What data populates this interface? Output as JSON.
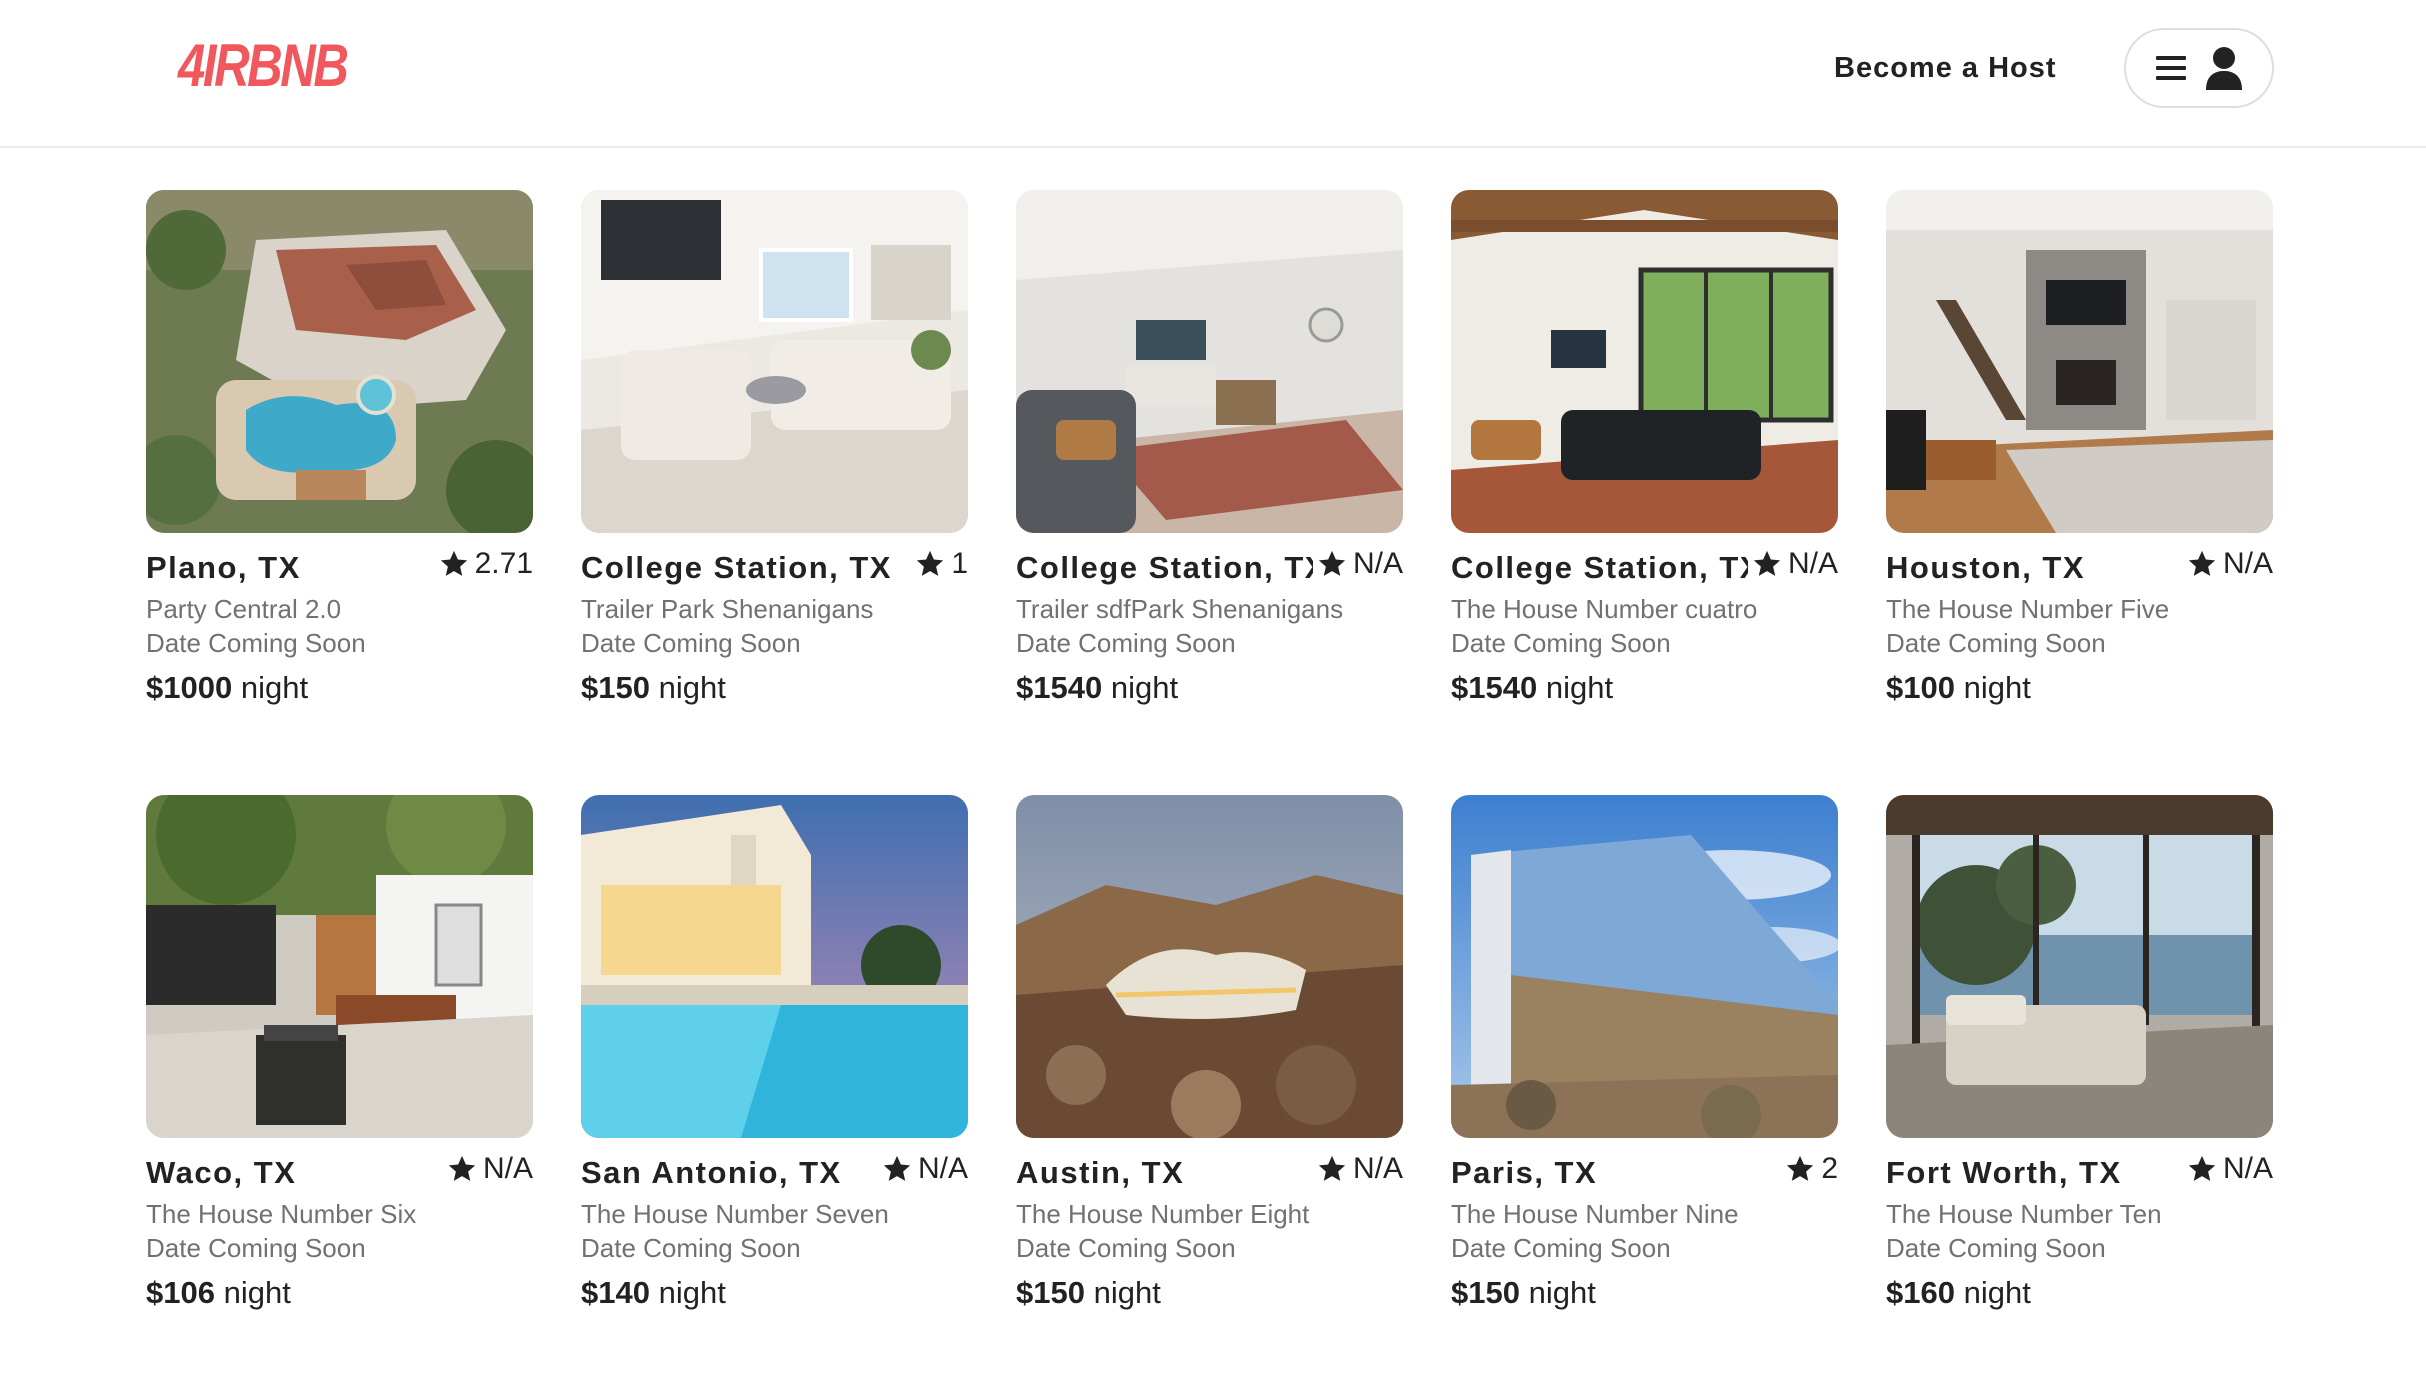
{
  "header": {
    "logo_text": "4IRBNB",
    "become_host_label": "Become a Host",
    "menu_icon": "hamburger-menu-icon",
    "user_icon": "user-avatar-icon",
    "brand_color": "#f0585e"
  },
  "listings": [
    {
      "city": "Plano, TX",
      "rating": "2.71",
      "title": "Party Central 2.0",
      "date": "Date Coming Soon",
      "price": "$1000",
      "unit": "night"
    },
    {
      "city": "College Station, TX",
      "rating": "1",
      "title": "Trailer Park Shenanigans",
      "date": "Date Coming Soon",
      "price": "$150",
      "unit": "night"
    },
    {
      "city": "College Station, TX",
      "rating": "N/A",
      "title": "Trailer sdfPark Shenanigans",
      "date": "Date Coming Soon",
      "price": "$1540",
      "unit": "night"
    },
    {
      "city": "College Station, TX",
      "rating": "N/A",
      "title": "The House Number cuatro",
      "date": "Date Coming Soon",
      "price": "$1540",
      "unit": "night"
    },
    {
      "city": "Houston, TX",
      "rating": "N/A",
      "title": "The House Number Five",
      "date": "Date Coming Soon",
      "price": "$100",
      "unit": "night"
    },
    {
      "city": "Waco, TX",
      "rating": "N/A",
      "title": "The House Number Six",
      "date": "Date Coming Soon",
      "price": "$106",
      "unit": "night"
    },
    {
      "city": "San Antonio, TX",
      "rating": "N/A",
      "title": "The House Number Seven",
      "date": "Date Coming Soon",
      "price": "$140",
      "unit": "night"
    },
    {
      "city": "Austin, TX",
      "rating": "N/A",
      "title": "The House Number Eight",
      "date": "Date Coming Soon",
      "price": "$150",
      "unit": "night"
    },
    {
      "city": "Paris, TX",
      "rating": "2",
      "title": "The House Number Nine",
      "date": "Date Coming Soon",
      "price": "$150",
      "unit": "night"
    },
    {
      "city": "Fort Worth, TX",
      "rating": "N/A",
      "title": "The House Number Ten",
      "date": "Date Coming Soon",
      "price": "$160",
      "unit": "night"
    }
  ],
  "rating_icon": "star-icon"
}
